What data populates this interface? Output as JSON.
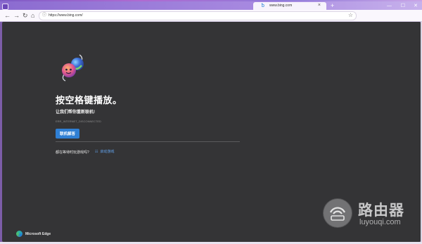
{
  "window": {
    "tab_title": "www.bing.com",
    "tab_close_glyph": "×",
    "new_tab_glyph": "+",
    "controls": {
      "minimize": "—",
      "maximize": "☐",
      "close": "✕"
    }
  },
  "toolbar": {
    "url": "https://www.bing.com/",
    "icons": [
      "back-icon",
      "forward-icon",
      "refresh-icon",
      "home-icon",
      "info-icon",
      "favorite-icon"
    ]
  },
  "page": {
    "title": "按空格键播放。",
    "subtitle": "让我们帮你重新联机!",
    "error_code": "ERR_INTERNET_DISCONNECTED",
    "troubleshoot_button": "联机解答",
    "waiting_question": "都在等待时玩游戏吗?",
    "start_game_link": "启动游戏",
    "brand": "Microsoft Edge"
  },
  "watermark": {
    "title": "路由器",
    "url": "luyouqi.com"
  },
  "colors": {
    "accent": "#2f7fd4",
    "content_bg": "#343436",
    "frame": "#7c5da8"
  }
}
